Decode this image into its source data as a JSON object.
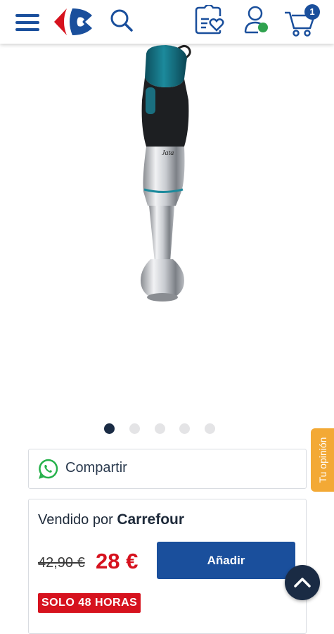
{
  "header": {
    "icons": {
      "menu": "menu-icon",
      "logo": "carrefour-logo",
      "search": "search-icon",
      "lists": "shopping-list-heart-icon",
      "account": "account-icon",
      "cart": "cart-icon"
    },
    "cart_count": "1"
  },
  "product": {
    "image": "hand-blender-image",
    "carousel": {
      "total": 5,
      "active_index": 0
    }
  },
  "share": {
    "label": "Compartir",
    "icon": "whatsapp-icon"
  },
  "feedback_tab": {
    "label": "Tu opinión"
  },
  "seller": {
    "prefix": "Vendido por",
    "name": "Carrefour",
    "old_price": "42,90 €",
    "price": "28 €",
    "add_label": "Añadir",
    "promo": "SOLO 48 HORAS"
  },
  "colors": {
    "brand_blue": "#1a4f9c",
    "price_red": "#d6121e",
    "navy": "#1a2b44",
    "feedback_orange": "#f3a935",
    "status_green": "#2fa24e"
  }
}
